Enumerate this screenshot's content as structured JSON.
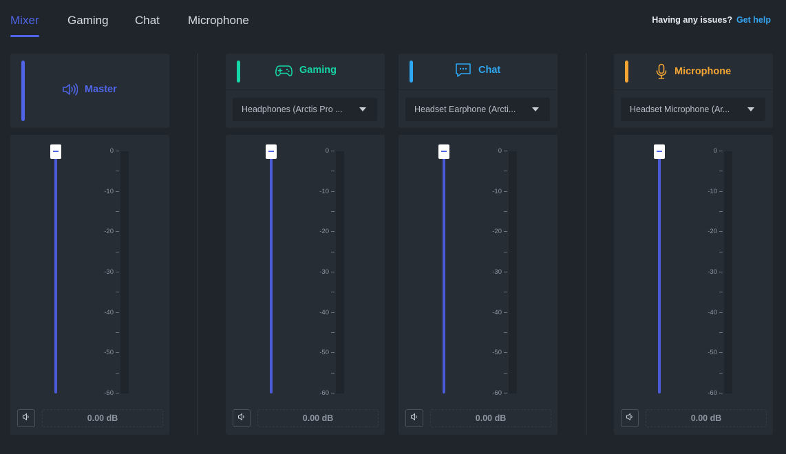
{
  "tabs": [
    {
      "label": "Mixer",
      "active": true
    },
    {
      "label": "Gaming",
      "active": false
    },
    {
      "label": "Chat",
      "active": false
    },
    {
      "label": "Microphone",
      "active": false
    }
  ],
  "help": {
    "question": "Having any issues?",
    "link": "Get help"
  },
  "channels": [
    {
      "name": "Master",
      "color": "#4f64e6",
      "icon": "speaker-icon",
      "device": "",
      "volume_db": "0.00 dB",
      "level_fraction": 1.0
    },
    {
      "name": "Gaming",
      "color": "#15d6a6",
      "icon": "gamepad-icon",
      "device": "Headphones (Arctis Pro ...",
      "volume_db": "0.00 dB",
      "level_fraction": 1.0
    },
    {
      "name": "Chat",
      "color": "#2ea7f2",
      "icon": "chat-bubble-icon",
      "device": "Headset Earphone (Arcti...",
      "volume_db": "0.00 dB",
      "level_fraction": 1.0
    },
    {
      "name": "Microphone",
      "color": "#f3a533",
      "icon": "microphone-icon",
      "device": "Headset Microphone (Ar...",
      "volume_db": "0.00 dB",
      "level_fraction": 1.0
    }
  ],
  "scale_labels": [
    "0",
    "-10",
    "-20",
    "-30",
    "-40",
    "-50",
    "-60"
  ]
}
